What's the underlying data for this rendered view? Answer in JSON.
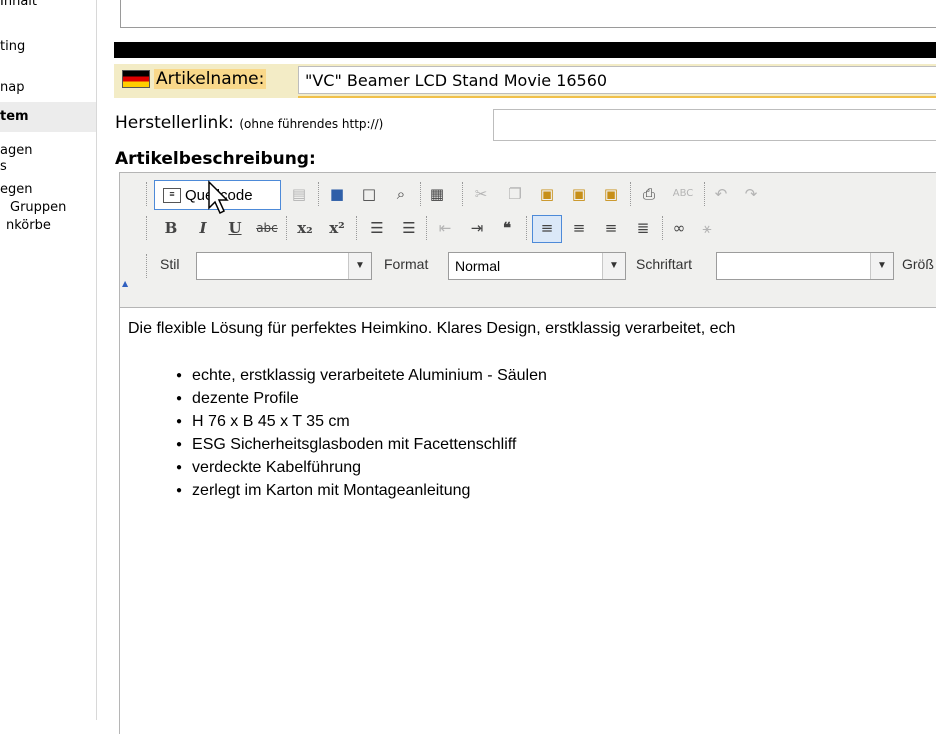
{
  "sidebar": {
    "items": [
      {
        "label": "Inhalt"
      },
      {
        "label": "ting"
      },
      {
        "label": "nap"
      },
      {
        "label": "tem"
      },
      {
        "label": "agen"
      },
      {
        "label": "s"
      },
      {
        "label": "egen"
      },
      {
        "label": "Gruppen"
      },
      {
        "label": "nkörbe"
      }
    ]
  },
  "article": {
    "name_label": "Artikelname:",
    "name_value": "\"VC\" Beamer LCD Stand Movie 16560",
    "flag_icon": "germany-flag-icon",
    "manufacturer_label": "Herstellerlink:",
    "manufacturer_note": "(ohne führendes http://)",
    "manufacturer_value": "",
    "description_label": "Artikelbeschreibung:"
  },
  "editor": {
    "source_button_label": "Quellcode",
    "style_label": "Stil",
    "style_value": "",
    "format_label": "Format",
    "format_value": "Normal",
    "font_label": "Schriftart",
    "font_value": "",
    "size_label": "Größ",
    "lead_text": "Die flexible Lösung für perfektes Heimkino. Klares Design, erstklassig verarbeitet, ech",
    "bullets": [
      "echte, erstklassig verarbeitete Aluminium - Säulen",
      "dezente Profile",
      "H 76 x B 45 x T 35 cm",
      "ESG Sicherheitsglasboden mit Facettenschliff",
      "verdeckte Kabelführung",
      "zerlegt im Karton mit Montageanleitung"
    ]
  },
  "colors": {
    "highlight": "#f9d88a",
    "name_row_bg": "#f3ecc6",
    "active_border": "#4d8ad8"
  }
}
